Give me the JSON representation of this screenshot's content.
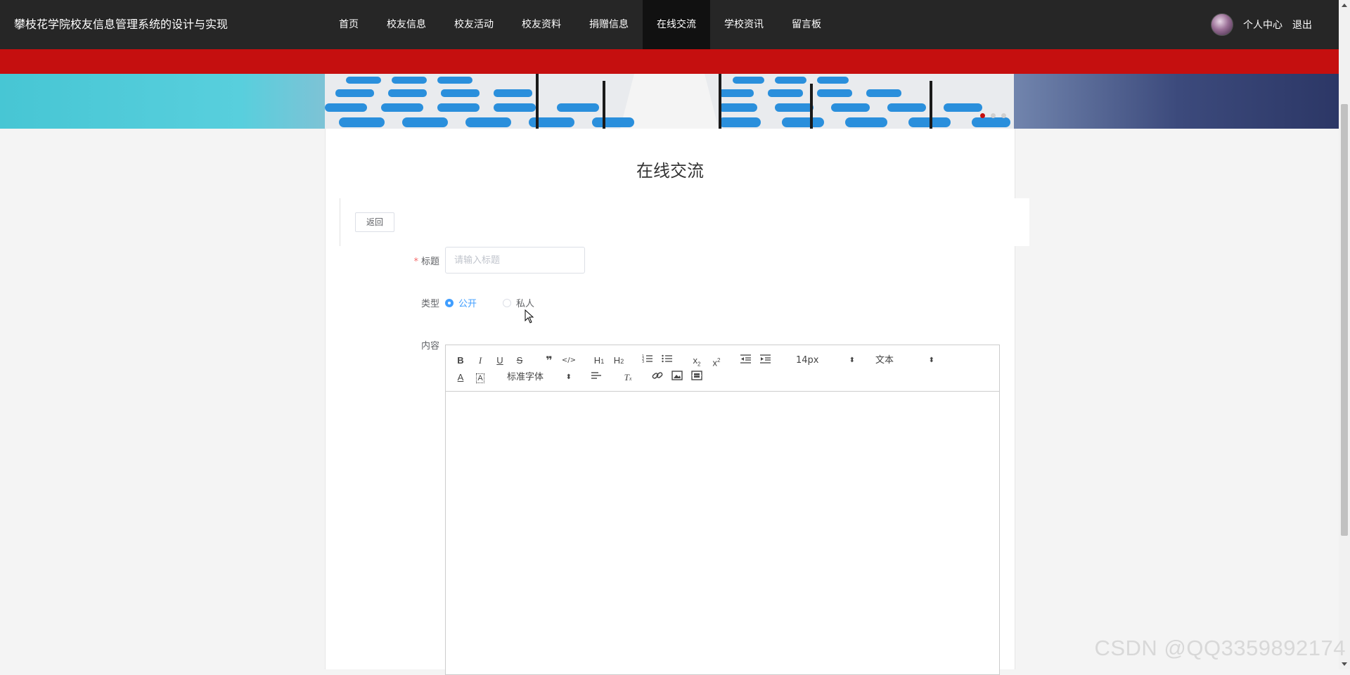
{
  "header": {
    "site_title": "攀枝花学院校友信息管理系统的设计与实现",
    "nav": [
      {
        "label": "首页",
        "active": false
      },
      {
        "label": "校友信息",
        "active": false
      },
      {
        "label": "校友活动",
        "active": false
      },
      {
        "label": "校友资料",
        "active": false
      },
      {
        "label": "捐赠信息",
        "active": false
      },
      {
        "label": "在线交流",
        "active": true
      },
      {
        "label": "学校资讯",
        "active": false
      },
      {
        "label": "留言板",
        "active": false
      }
    ],
    "user_center": "个人中心",
    "logout": "退出"
  },
  "banner": {
    "current_slide": 1,
    "slides": 3
  },
  "page": {
    "title": "在线交流"
  },
  "form": {
    "back_label": "返回",
    "title_label": "标题",
    "title_placeholder": "请输入标题",
    "title_value": "",
    "type_label": "类型",
    "type_options": [
      "公开",
      "私人"
    ],
    "type_selected": "公开",
    "content_label": "内容"
  },
  "editor": {
    "font_size": "14px",
    "header_select": "文本",
    "font_family": "标准字体",
    "tools_row1": [
      "bold-icon",
      "italic-icon",
      "underline-icon",
      "strike-icon",
      "blockquote-icon",
      "code-block-icon",
      "h1-icon",
      "h2-icon",
      "ordered-list-icon",
      "bullet-list-icon",
      "subscript-icon",
      "superscript-icon",
      "outdent-icon",
      "indent-icon"
    ],
    "tools_row2": [
      "text-color-icon",
      "background-color-icon",
      "align-icon",
      "clear-format-icon",
      "link-icon",
      "image-icon",
      "video-icon"
    ]
  },
  "colors": {
    "nav_bg": "#262626",
    "accent_red": "#c50f0f",
    "primary_blue": "#409eff"
  },
  "watermark": "CSDN @QQ3359892174"
}
